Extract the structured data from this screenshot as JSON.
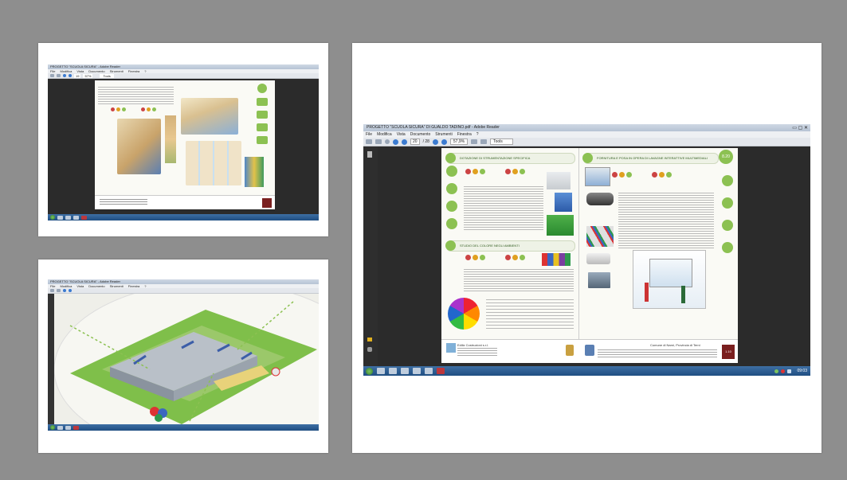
{
  "large": {
    "window_title": "PROGETTO \"SCUOLA SICURA\" DI GUALDO TADINO.pdf - Adobe Reader",
    "menu": [
      "File",
      "Modifica",
      "Vista",
      "Documento",
      "Strumenti",
      "Finestra",
      "?"
    ],
    "page_number": "20",
    "page_total": "/ 28",
    "zoom": "57,9%",
    "tools_label": "Tools",
    "section_left_1": "DOTAZIONE DI STRUMENTAZIONE SPECIFICA",
    "section_left_2": "STUDIO DEL COLORE NEGLI AMBIENTI",
    "section_right": "FORNITURA E POSA IN OPERA DI LAVAGNE INTERATTIVE MULTIMEDIALI",
    "page_badge": "8.20",
    "footer_company": "Ediliz Costruzioni s.r.l.",
    "footer_client": "Comune di Narni, Provincia di Terni",
    "footer_num": "1.10",
    "clock": "09:03"
  },
  "top_left": {
    "window_title": "PROGETTO \"SCUOLA SICURA\" - Adobe Reader",
    "menu": [
      "File",
      "Modifica",
      "Vista",
      "Documento",
      "Strumenti",
      "Finestra",
      "?"
    ],
    "page_info": "19",
    "zoom": "57%",
    "tools_label": "Tools"
  },
  "bottom_left": {
    "window_title": "PROGETTO \"SCUOLA SICURA\" - Adobe Reader",
    "menu": [
      "File",
      "Modifica",
      "Vista",
      "Documento",
      "Strumenti",
      "Finestra",
      "?"
    ]
  },
  "colors": {
    "background": "#8e8e8e",
    "accent_green": "#8cc152",
    "taskbar": "#1f4e82"
  }
}
